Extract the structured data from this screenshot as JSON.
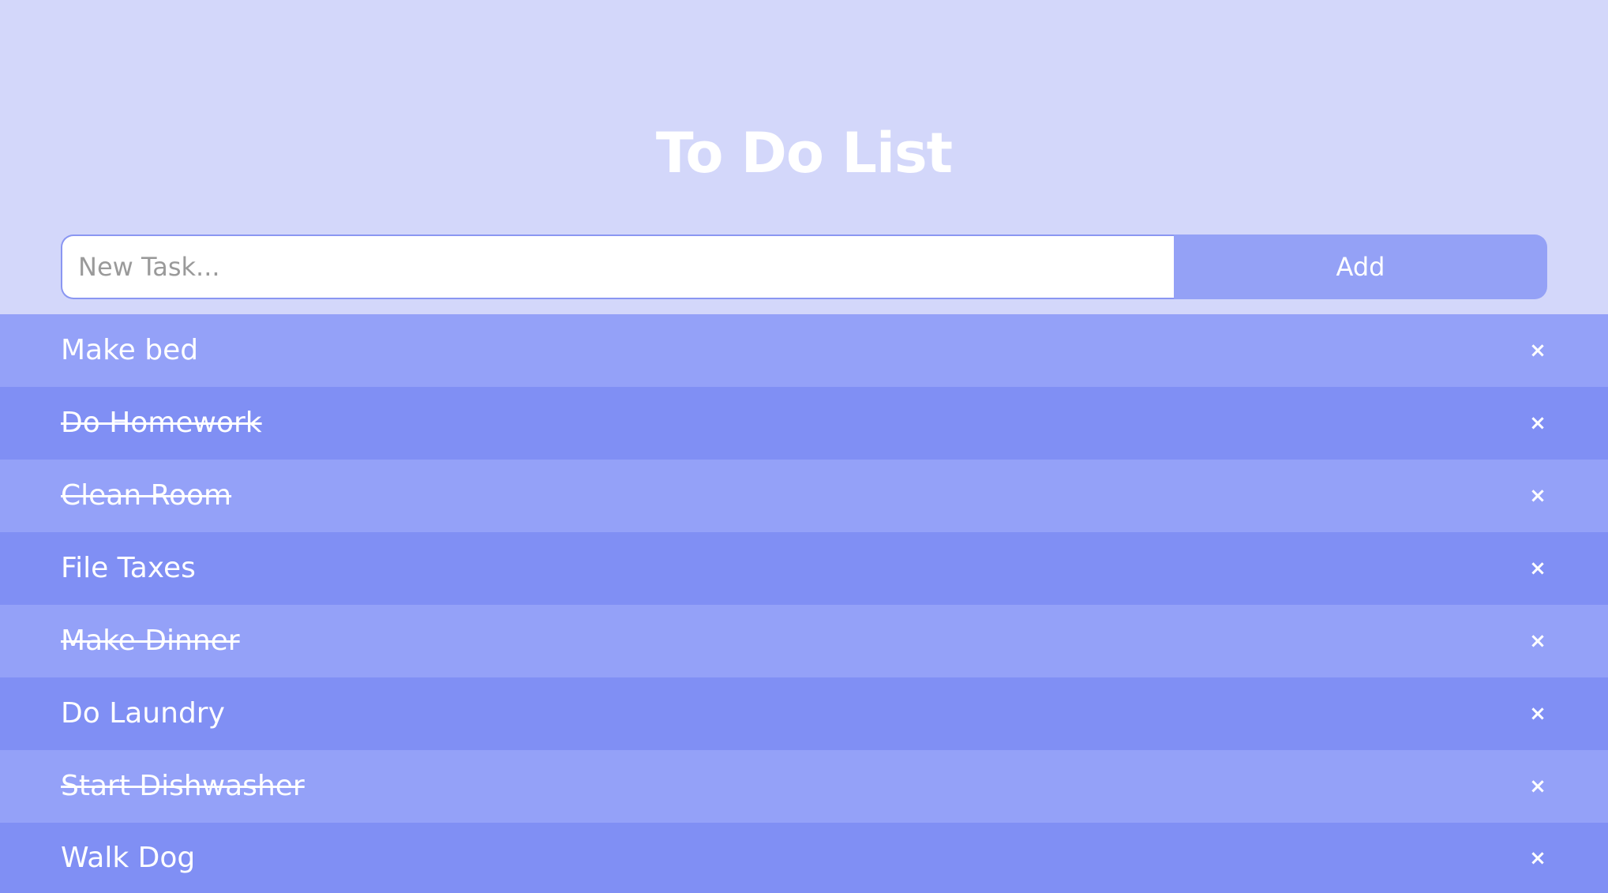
{
  "app": {
    "title": "To Do List"
  },
  "form": {
    "input_value": "",
    "input_placeholder": "New Task...",
    "add_label": "Add"
  },
  "tasks": [
    {
      "text": "Make bed",
      "completed": false
    },
    {
      "text": "Do Homework",
      "completed": true
    },
    {
      "text": "Clean Room",
      "completed": true
    },
    {
      "text": "File Taxes",
      "completed": false
    },
    {
      "text": "Make Dinner",
      "completed": true
    },
    {
      "text": "Do Laundry",
      "completed": false
    },
    {
      "text": "Start Dishwasher",
      "completed": true
    },
    {
      "text": "Walk Dog",
      "completed": false
    }
  ],
  "icons": {
    "delete": "close-icon",
    "delete_glyph": "×"
  },
  "colors": {
    "background": "#d3d7fa",
    "row_light": "#94a1f8",
    "row_dark": "#808ff4",
    "button": "#94a1f6",
    "text": "#ffffff"
  }
}
